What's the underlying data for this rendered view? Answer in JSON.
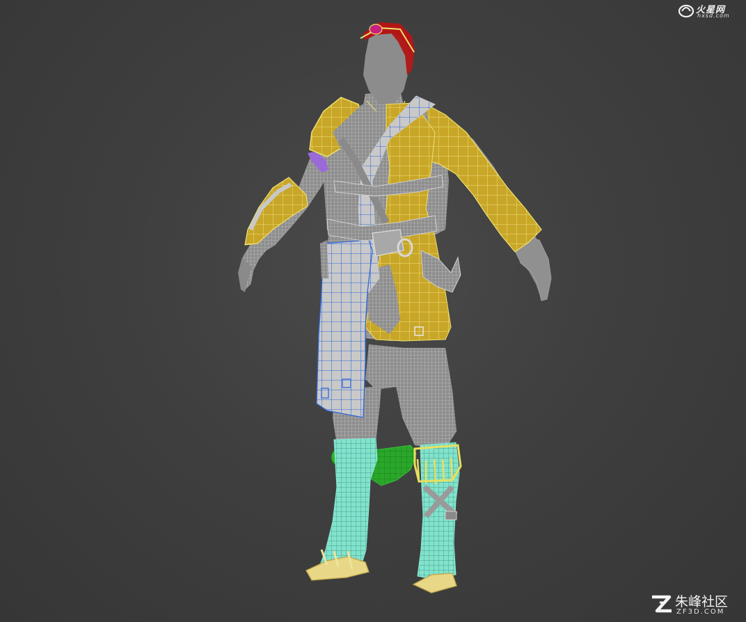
{
  "scene": {
    "background_color": "#3e3e3e",
    "material_colors": {
      "body": "#8f8f8f",
      "wire_body": "#d8d8d8",
      "cloth_yellow": "#c9a92a",
      "wire_yellow": "#f0e070",
      "sash_white": "#c8c8c8",
      "sash_wire": "#3a6fd8",
      "hat_red": "#b01818",
      "gem_magenta": "#c02080",
      "armband_purple": "#9a6ad8",
      "boot_cyan": "#7fe0c8",
      "boot_wire": "#2a8a70",
      "dagger_green": "#2aa82a",
      "fringe_yellow": "#e8e060",
      "sole_yellow": "#e8d880"
    }
  },
  "watermarks": {
    "top_right": {
      "title": "火星网",
      "subtitle": "hxsd.com"
    },
    "bottom_right": {
      "title": "朱峰社区",
      "subtitle": "ZF3D.COM"
    }
  }
}
